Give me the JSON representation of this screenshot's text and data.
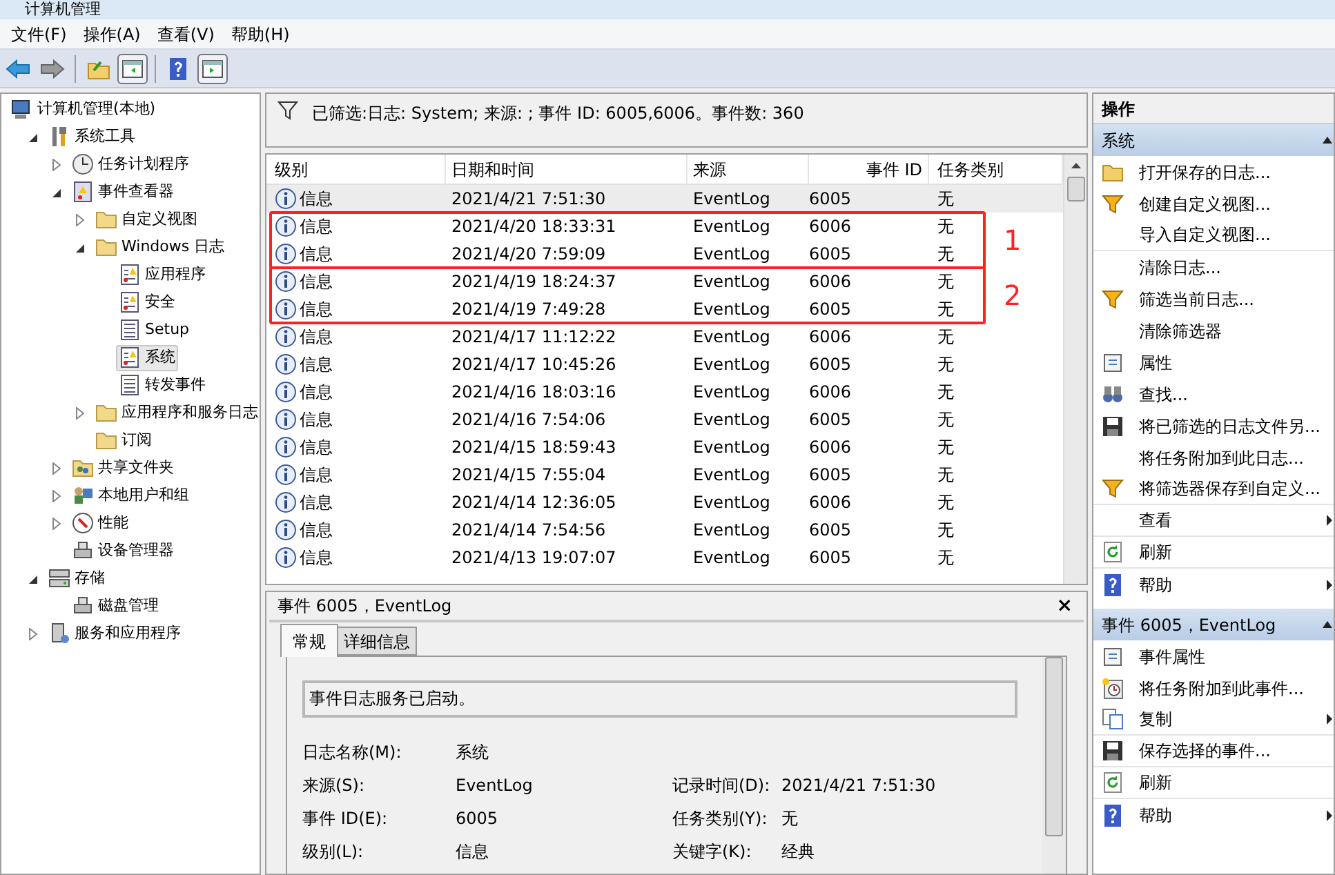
{
  "window": {
    "title": "计算机管理"
  },
  "menu": [
    {
      "label": "文件(F)"
    },
    {
      "label": "操作(A)"
    },
    {
      "label": "查看(V)"
    },
    {
      "label": "帮助(H)"
    }
  ],
  "toolbar": [
    {
      "kind": "back",
      "selected": false
    },
    {
      "kind": "forward",
      "selected": false
    },
    {
      "kind": "sep"
    },
    {
      "kind": "up",
      "selected": false
    },
    {
      "kind": "tree",
      "selected": true
    },
    {
      "kind": "sep"
    },
    {
      "kind": "help",
      "selected": false
    },
    {
      "kind": "actions",
      "selected": true
    }
  ],
  "tree": [
    {
      "label": "计算机管理(本地)",
      "kind": "computer",
      "selected": false,
      "children": [
        {
          "label": "系统工具",
          "kind": "tools",
          "expanded": true,
          "selected": false,
          "children": [
            {
              "label": "任务计划程序",
              "kind": "clock",
              "expanded": false,
              "selected": false
            },
            {
              "label": "事件查看器",
              "kind": "viewer",
              "expanded": true,
              "selected": false,
              "children": [
                {
                  "label": "自定义视图",
                  "kind": "folder",
                  "expanded": false,
                  "selected": false
                },
                {
                  "label": "Windows 日志",
                  "kind": "folder",
                  "expanded": true,
                  "selected": false,
                  "children": [
                    {
                      "label": "应用程序",
                      "kind": "logwarn",
                      "selected": false
                    },
                    {
                      "label": "安全",
                      "kind": "logwarn",
                      "selected": false
                    },
                    {
                      "label": "Setup",
                      "kind": "log",
                      "selected": false
                    },
                    {
                      "label": "系统",
                      "kind": "logwarn",
                      "selected": true
                    },
                    {
                      "label": "转发事件",
                      "kind": "log",
                      "selected": false
                    }
                  ]
                },
                {
                  "label": "应用程序和服务日志",
                  "kind": "folder",
                  "expanded": false,
                  "selected": false
                },
                {
                  "label": "订阅",
                  "kind": "folder",
                  "selected": false
                }
              ]
            },
            {
              "label": "共享文件夹",
              "kind": "share",
              "expanded": false,
              "selected": false
            },
            {
              "label": "本地用户和组",
              "kind": "users",
              "expanded": false,
              "selected": false
            },
            {
              "label": "性能",
              "kind": "perf",
              "expanded": false,
              "selected": false
            },
            {
              "label": "设备管理器",
              "kind": "device",
              "selected": false
            }
          ]
        },
        {
          "label": "存储",
          "kind": "storage",
          "expanded": true,
          "selected": false,
          "children": [
            {
              "label": "磁盘管理",
              "kind": "device",
              "selected": false
            }
          ]
        },
        {
          "label": "服务和应用程序",
          "kind": "services",
          "expanded": false,
          "selected": false
        }
      ]
    }
  ],
  "filter_bar": {
    "text": "已筛选:日志: System; 来源: ; 事件 ID: 6005,6006。事件数: 360"
  },
  "table": {
    "columns": [
      "级别",
      "日期和时间",
      "来源",
      "事件 ID",
      "任务类别"
    ],
    "annotations": [
      {
        "label": "1"
      },
      {
        "label": "2"
      }
    ],
    "rows": [
      {
        "level": "信息",
        "date": "2021/4/21 7:51:30",
        "source": "EventLog",
        "id": "6005",
        "task": "无",
        "selected": true
      },
      {
        "level": "信息",
        "date": "2021/4/20 18:33:31",
        "source": "EventLog",
        "id": "6006",
        "task": "无",
        "selected": false,
        "boxed": true
      },
      {
        "level": "信息",
        "date": "2021/4/20 7:59:09",
        "source": "EventLog",
        "id": "6005",
        "task": "无",
        "selected": false,
        "boxed": true
      },
      {
        "level": "信息",
        "date": "2021/4/19 18:24:37",
        "source": "EventLog",
        "id": "6006",
        "task": "无",
        "selected": false,
        "boxed": true,
        "box_start": true
      },
      {
        "level": "信息",
        "date": "2021/4/19 7:49:28",
        "source": "EventLog",
        "id": "6005",
        "task": "无",
        "selected": false,
        "boxed": true
      },
      {
        "level": "信息",
        "date": "2021/4/17 11:12:22",
        "source": "EventLog",
        "id": "6006",
        "task": "无",
        "selected": false
      },
      {
        "level": "信息",
        "date": "2021/4/17 10:45:26",
        "source": "EventLog",
        "id": "6005",
        "task": "无",
        "selected": false
      },
      {
        "level": "信息",
        "date": "2021/4/16 18:03:16",
        "source": "EventLog",
        "id": "6006",
        "task": "无",
        "selected": false
      },
      {
        "level": "信息",
        "date": "2021/4/16 7:54:06",
        "source": "EventLog",
        "id": "6005",
        "task": "无",
        "selected": false
      },
      {
        "level": "信息",
        "date": "2021/4/15 18:59:43",
        "source": "EventLog",
        "id": "6006",
        "task": "无",
        "selected": false
      },
      {
        "level": "信息",
        "date": "2021/4/15 7:55:04",
        "source": "EventLog",
        "id": "6005",
        "task": "无",
        "selected": false
      },
      {
        "level": "信息",
        "date": "2021/4/14 12:36:05",
        "source": "EventLog",
        "id": "6006",
        "task": "无",
        "selected": false
      },
      {
        "level": "信息",
        "date": "2021/4/14 7:54:56",
        "source": "EventLog",
        "id": "6005",
        "task": "无",
        "selected": false
      },
      {
        "level": "信息",
        "date": "2021/4/13 19:07:07",
        "source": "EventLog",
        "id": "6005",
        "task": "无",
        "selected": false
      }
    ]
  },
  "detail": {
    "title": "事件 6005，EventLog",
    "close": "×",
    "tabs": [
      {
        "label": "常规",
        "selected": true
      },
      {
        "label": "详细信息",
        "selected": false
      }
    ],
    "message": "事件日志服务已启动。",
    "fields": [
      {
        "left": {
          "label": "日志名称(M):",
          "value": "系统"
        }
      },
      {
        "left": {
          "label": "来源(S):",
          "value": "EventLog"
        },
        "right": {
          "label": "记录时间(D):",
          "value": "2021/4/21 7:51:30"
        }
      },
      {
        "left": {
          "label": "事件 ID(E):",
          "value": "6005"
        },
        "right": {
          "label": "任务类别(Y):",
          "value": "无"
        }
      },
      {
        "left": {
          "label": "级别(L):",
          "value": "信息"
        },
        "right": {
          "label": "关键字(K):",
          "value": "经典"
        }
      }
    ]
  },
  "actions": {
    "title": "操作",
    "sections": [
      {
        "title": "系统",
        "items": [
          {
            "label": "打开保存的日志...",
            "kind": "open",
            "submenu": false,
            "divider_after": false
          },
          {
            "label": "创建自定义视图...",
            "kind": "funnel",
            "submenu": false,
            "divider_after": false
          },
          {
            "label": "导入自定义视图...",
            "kind": "none",
            "submenu": false,
            "divider_after": true
          },
          {
            "label": "清除日志...",
            "kind": "none",
            "submenu": false,
            "divider_after": false
          },
          {
            "label": "筛选当前日志...",
            "kind": "funnel",
            "submenu": false,
            "divider_after": false
          },
          {
            "label": "清除筛选器",
            "kind": "none",
            "submenu": false,
            "divider_after": false
          },
          {
            "label": "属性",
            "kind": "props",
            "submenu": false,
            "divider_after": false
          },
          {
            "label": "查找...",
            "kind": "find",
            "submenu": false,
            "divider_after": false
          },
          {
            "label": "将已筛选的日志文件另...",
            "kind": "save",
            "submenu": false,
            "divider_after": false
          },
          {
            "label": "将任务附加到此日志...",
            "kind": "none",
            "submenu": false,
            "divider_after": false
          },
          {
            "label": "将筛选器保存到自定义...",
            "kind": "funnel",
            "submenu": false,
            "divider_after": true
          },
          {
            "label": "查看",
            "kind": "none",
            "submenu": true,
            "divider_after": true
          },
          {
            "label": "刷新",
            "kind": "refresh",
            "submenu": false,
            "divider_after": true
          },
          {
            "label": "帮助",
            "kind": "help",
            "submenu": true,
            "divider_after": false
          }
        ]
      },
      {
        "title": "事件 6005，EventLog",
        "items": [
          {
            "label": "事件属性",
            "kind": "props",
            "submenu": false,
            "divider_after": false
          },
          {
            "label": "将任务附加到此事件...",
            "kind": "task",
            "submenu": false,
            "divider_after": false
          },
          {
            "label": "复制",
            "kind": "copy",
            "submenu": true,
            "divider_after": true
          },
          {
            "label": "保存选择的事件...",
            "kind": "save",
            "submenu": false,
            "divider_after": true
          },
          {
            "label": "刷新",
            "kind": "refresh",
            "submenu": false,
            "divider_after": true
          },
          {
            "label": "帮助",
            "kind": "help",
            "submenu": true,
            "divider_after": false
          }
        ]
      }
    ]
  }
}
